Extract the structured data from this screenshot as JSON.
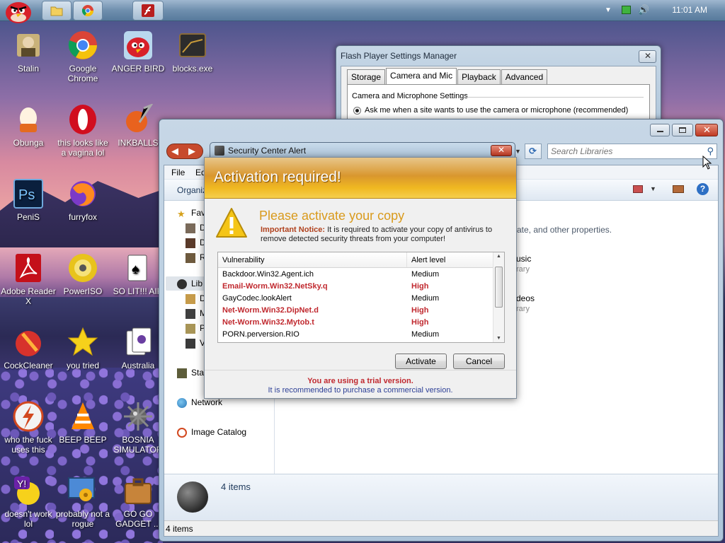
{
  "taskbar": {
    "clock": "11:01 AM",
    "buttons": [
      "angry-bird",
      "folder",
      "chrome",
      "flash"
    ]
  },
  "desktop_icons": [
    {
      "label": "Stalin",
      "icon": "stalin-icon"
    },
    {
      "label": "Google Chrome",
      "icon": "chrome-icon"
    },
    {
      "label": "ANGER BIRD",
      "icon": "angry-bird-icon"
    },
    {
      "label": "blocks.exe",
      "icon": "blocks-icon"
    },
    {
      "label": "Obunga",
      "icon": "egg-icon"
    },
    {
      "label": "this looks like a vagina lol",
      "icon": "opera-icon"
    },
    {
      "label": "INKBALLS",
      "icon": "inkball-icon"
    },
    {
      "label": "PeniS",
      "icon": "photoshop-icon"
    },
    {
      "label": "furryfox",
      "icon": "firefox-icon"
    },
    {
      "label": "Adobe Reader X",
      "icon": "adobe-reader-icon"
    },
    {
      "label": "PowerISO",
      "icon": "poweriso-icon"
    },
    {
      "label": "SO LIT!!! AIR",
      "icon": "cards-icon"
    },
    {
      "label": "CockCleaner",
      "icon": "ccleaner-icon"
    },
    {
      "label": "you tried",
      "icon": "star-icon"
    },
    {
      "label": "Australia",
      "icon": "spider-cards-icon"
    },
    {
      "label": "who the fuck uses this",
      "icon": "flash-icon"
    },
    {
      "label": "BEEP BEEP",
      "icon": "vlc-icon"
    },
    {
      "label": "BOSNIA SIMULATOR",
      "icon": "mine-icon"
    },
    {
      "label": "doesn't work lol",
      "icon": "yahoo-icon"
    },
    {
      "label": "probably not a rogue",
      "icon": "settings-monitor-icon"
    },
    {
      "label": "GO GO GADGET ...",
      "icon": "briefcase-icon"
    }
  ],
  "flash_window": {
    "title": "Flash Player Settings Manager",
    "tabs": [
      "Storage",
      "Camera and Mic",
      "Playback",
      "Advanced"
    ],
    "active_tab": "Camera and Mic",
    "section": "Camera and Microphone Settings",
    "radio_label": "Ask me when a site wants to use the camera or microphone (recommended)"
  },
  "explorer": {
    "search_placeholder": "Search Libraries",
    "menu": [
      "File",
      "Ed"
    ],
    "organize": "Organiz",
    "nav": {
      "favorites": "Fav",
      "fav_items": [
        "D",
        "D",
        "R"
      ],
      "libraries": "Lib",
      "lib_items": [
        "D",
        "M",
        "P",
        "V"
      ],
      "startup": "Sta",
      "network": "Network",
      "image_catalog": "Image Catalog"
    },
    "content_fragments": {
      "description": "ate, and other properties.",
      "music": "usic",
      "music_sub": "rary",
      "videos": "deos",
      "videos_sub": "rary"
    },
    "details_count": "4 items",
    "status": "4 items"
  },
  "security_alert": {
    "window_title": "Security Center Alert",
    "banner": "Activation required!",
    "heading": "Please activate your copy",
    "notice_bold": "Important Notice:",
    "notice_text": " It is required to activate your copy of antivirus to remove detected security threats from your computer!",
    "columns": [
      "Vulnerability",
      "Alert level"
    ],
    "rows": [
      {
        "name": "Backdoor.Win32.Agent.ich",
        "level": "Medium",
        "high": false
      },
      {
        "name": "Email-Worm.Win32.NetSky.q",
        "level": "High",
        "high": true
      },
      {
        "name": "GayCodec.lookAlert",
        "level": "Medium",
        "high": false
      },
      {
        "name": "Net-Worm.Win32.DipNet.d",
        "level": "High",
        "high": true
      },
      {
        "name": "Net-Worm.Win32.Mytob.t",
        "level": "High",
        "high": true
      },
      {
        "name": "PORN.perversion.RIO",
        "level": "Medium",
        "high": false
      }
    ],
    "activate_label": "Activate",
    "cancel_label": "Cancel",
    "footer_line1": "You are using a trial version.",
    "footer_line2": "It is recommended to purchase a commercial version."
  },
  "colors": {
    "high_alert": "#c0282e",
    "banner_orange": "#e4a02a",
    "heading_orange": "#d99a1c",
    "footer_blue": "#2c3f96"
  }
}
